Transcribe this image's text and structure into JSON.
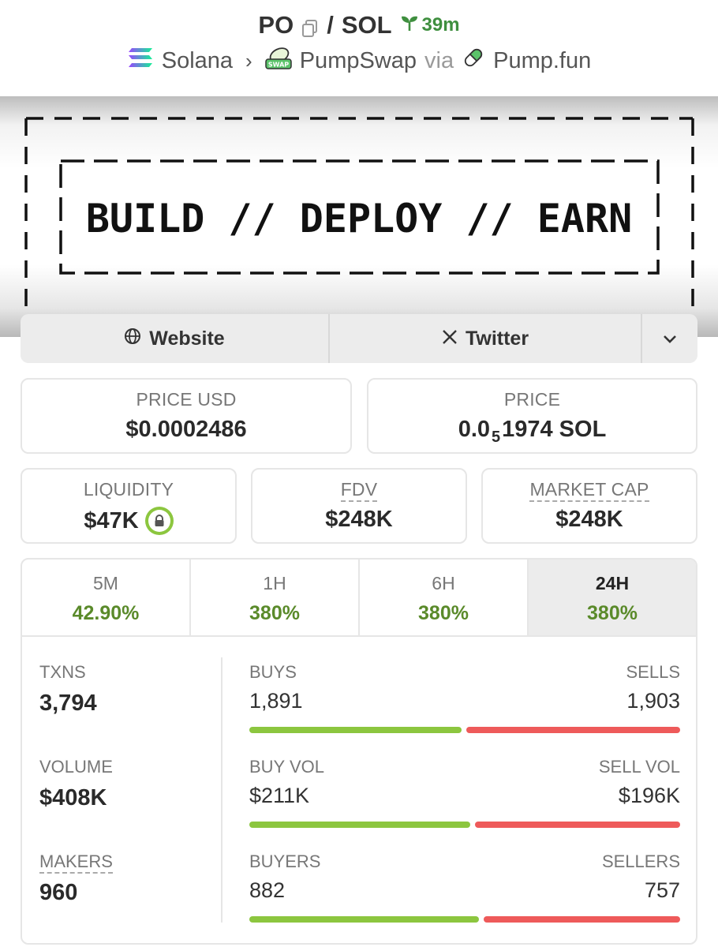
{
  "header": {
    "base_symbol": "PO",
    "separator": "/",
    "quote_symbol": "SOL",
    "age": "39m",
    "chain": "Solana",
    "dex": "PumpSwap",
    "via_label": "via",
    "launchpad": "Pump.fun",
    "dex_badge_text": "SWAP"
  },
  "banner": {
    "text": "BUILD // DEPLOY // EARN"
  },
  "links": {
    "website_label": "Website",
    "twitter_label": "Twitter",
    "icons": [
      "globe-icon",
      "x-logo-icon",
      "chevron-down-icon"
    ]
  },
  "prices": {
    "price_usd_label": "PRICE USD",
    "price_usd": "$0.0002486",
    "price_label": "PRICE",
    "price_sol_prefix": "0.0",
    "price_sol_zeros": "5",
    "price_sol_digits": "1974",
    "price_sol_unit": "SOL"
  },
  "metrics": {
    "liquidity_label": "LIQUIDITY",
    "liquidity": "$47K",
    "fdv_label": "FDV",
    "fdv": "$248K",
    "mcap_label": "MARKET CAP",
    "mcap": "$248K"
  },
  "tabs": [
    {
      "label": "5M",
      "change": "42.90%"
    },
    {
      "label": "1H",
      "change": "380%"
    },
    {
      "label": "6H",
      "change": "380%"
    },
    {
      "label": "24H",
      "change": "380%"
    }
  ],
  "stats": {
    "txns_label": "TXNS",
    "txns": "3,794",
    "volume_label": "VOLUME",
    "volume": "$408K",
    "makers_label": "MAKERS",
    "makers": "960",
    "buys_label": "BUYS",
    "buys": "1,891",
    "sells_label": "SELLS",
    "sells": "1,903",
    "buys_fraction": 0.498,
    "buy_vol_label": "BUY VOL",
    "buy_vol": "$211K",
    "sell_vol_label": "SELL VOL",
    "sell_vol": "$196K",
    "buy_vol_fraction": 0.518,
    "buyers_label": "BUYERS",
    "buyers": "882",
    "sellers_label": "SELLERS",
    "sellers": "757",
    "buyers_fraction": 0.538
  },
  "colors": {
    "buy": "#8cc63f",
    "sell": "#ee5a5a",
    "positive": "#5a8a2a",
    "age": "#3f8f3f"
  }
}
